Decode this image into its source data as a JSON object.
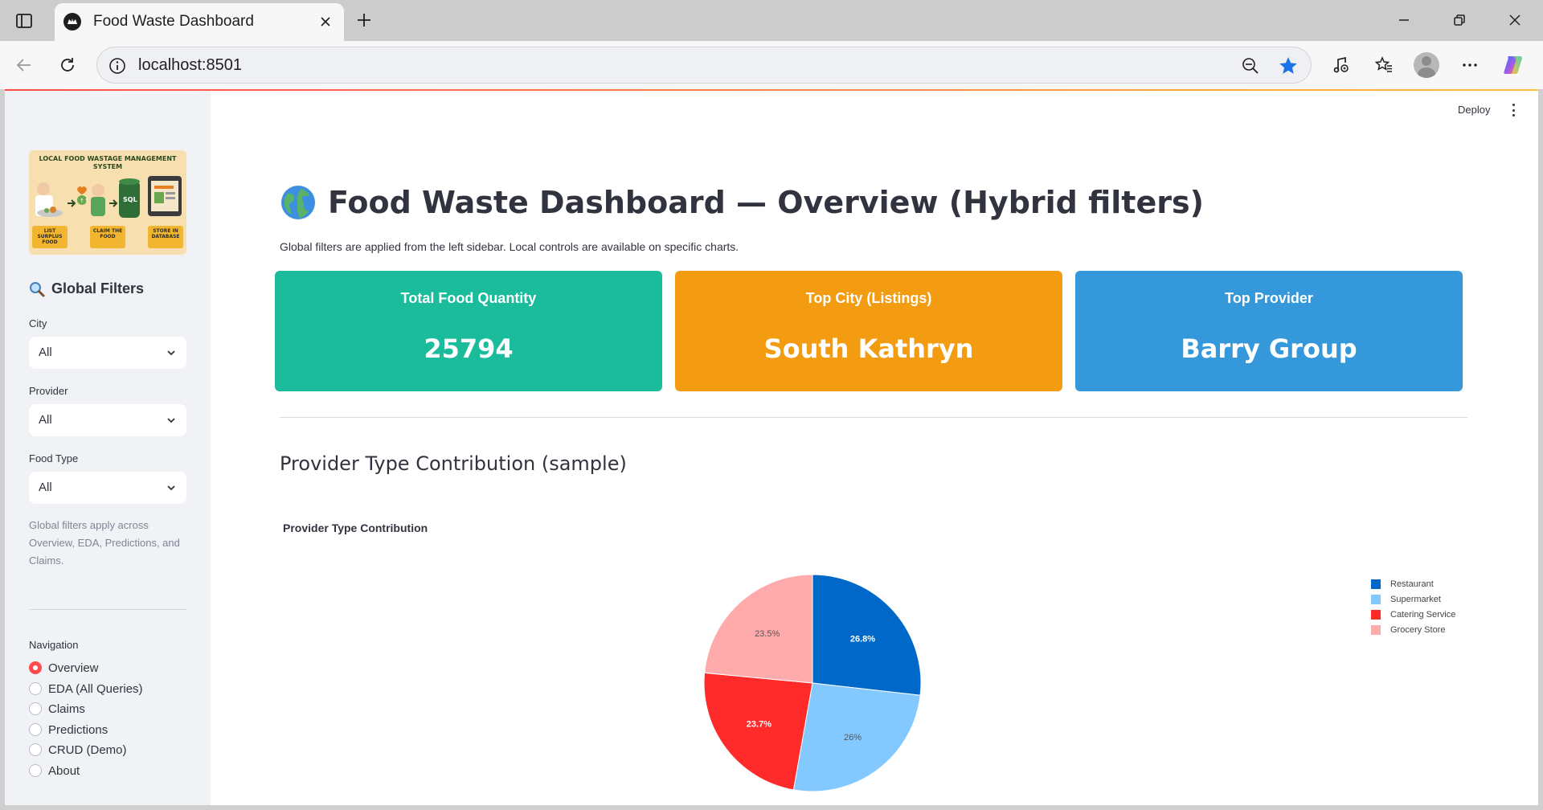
{
  "browser": {
    "tab_title": "Food Waste Dashboard",
    "url": "localhost:8501"
  },
  "sidebar": {
    "logo": {
      "title": "LOCAL FOOD WASTAGE MANAGEMENT SYSTEM",
      "badge": "SQL",
      "steps": [
        "LIST SURPLUS FOOD",
        "CLAIM THE FOOD",
        "STORE IN DATABASE"
      ]
    },
    "filters_heading": "Global Filters",
    "filters": [
      {
        "label": "City",
        "value": "All"
      },
      {
        "label": "Provider",
        "value": "All"
      },
      {
        "label": "Food Type",
        "value": "All"
      }
    ],
    "note": "Global filters apply across Overview, EDA, Predictions, and Claims.",
    "navigation_label": "Navigation",
    "nav_items": [
      {
        "label": "Overview",
        "selected": true
      },
      {
        "label": "EDA (All Queries)",
        "selected": false
      },
      {
        "label": "Claims",
        "selected": false
      },
      {
        "label": "Predictions",
        "selected": false
      },
      {
        "label": "CRUD (Demo)",
        "selected": false
      },
      {
        "label": "About",
        "selected": false
      }
    ]
  },
  "header": {
    "deploy_label": "Deploy"
  },
  "main": {
    "title": "Food Waste Dashboard — Overview (Hybrid filters)",
    "subtitle": "Global filters are applied from the left sidebar. Local controls are available on specific charts.",
    "kpis": [
      {
        "label": "Total Food Quantity",
        "value": "25794",
        "color": "#1abc9c"
      },
      {
        "label": "Top City (Listings)",
        "value": "South Kathryn",
        "color": "#f39c12"
      },
      {
        "label": "Top Provider",
        "value": "Barry Group",
        "color": "#3498db"
      }
    ],
    "section_title": "Provider Type Contribution (sample)"
  },
  "chart_data": {
    "type": "pie",
    "title": "Provider Type Contribution",
    "categories": [
      "Restaurant",
      "Supermarket",
      "Catering Service",
      "Grocery Store"
    ],
    "values": [
      26.8,
      26,
      23.7,
      23.5
    ],
    "labels": [
      "26.8%",
      "26%",
      "23.7%",
      "23.5%"
    ],
    "colors": [
      "#0068c9",
      "#83c9ff",
      "#ff2b2b",
      "#ffabab"
    ],
    "label_colors": [
      "#ffffff",
      "#555555",
      "#ffffff",
      "#555555"
    ],
    "legend_position": "right"
  }
}
